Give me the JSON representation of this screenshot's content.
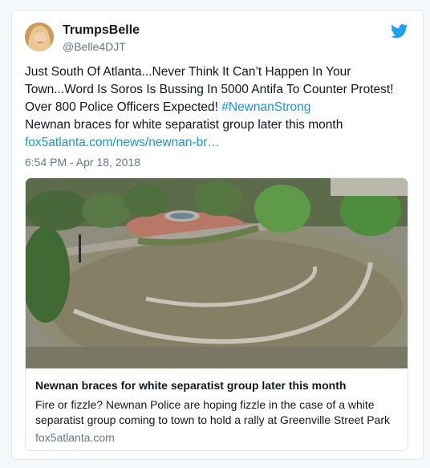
{
  "tweet": {
    "display_name": "TrumpsBelle",
    "handle": "@Belle4DJT",
    "text_part1": "Just South Of Atlanta...Never Think It Can’t Happen In Your Town...Word Is Soros Is Bussing In 5000 Antifa To Counter Protest! Over 800 Police Officers Expected! ",
    "hashtag": "#NewnanStrong",
    "text_line2": "Newnan braces for white separatist group later this month",
    "link": "fox5atlanta.com/news/newnan-br…",
    "timestamp": "6:54 PM - Apr 18, 2018"
  },
  "preview": {
    "title": "Newnan braces for white separatist group later this month",
    "description": "Fire or fizzle? Newnan Police are hoping fizzle in the case of a white separatist group coming to town to hold a rally at Greenville Street Park",
    "domain": "fox5atlanta.com"
  },
  "icons": {
    "brand": "twitter-bird-icon",
    "avatar": "user-avatar"
  },
  "colors": {
    "link": "#1b95e0",
    "bird": "#1da1f2",
    "text": "#14171a",
    "muted": "#657786"
  }
}
